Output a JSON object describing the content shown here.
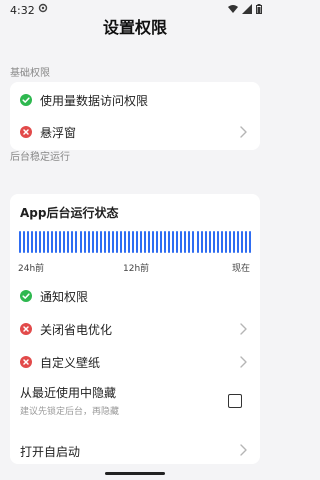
{
  "status_bar": {
    "time": "4:32"
  },
  "page": {
    "title": "设置权限"
  },
  "sections": {
    "basic": {
      "label": "基础权限",
      "items": [
        {
          "label": "使用量数据访问权限",
          "status": "granted"
        },
        {
          "label": "悬浮窗",
          "status": "denied"
        }
      ]
    },
    "background": {
      "label": "后台稳定运行",
      "chart": {
        "title": "App后台运行状态",
        "x_labels": [
          "24h前",
          "12h前",
          "现在"
        ]
      },
      "items": [
        {
          "label": "通知权限",
          "status": "granted"
        },
        {
          "label": "关闭省电优化",
          "status": "denied"
        },
        {
          "label": "自定义壁纸",
          "status": "denied"
        }
      ],
      "hide_recent": {
        "label": "从最近使用中隐藏",
        "note": "建议先锁定后台，再隐藏",
        "checked": false
      },
      "auto_start": {
        "label": "打开自启动"
      }
    }
  },
  "colors": {
    "granted": "#2eb84f",
    "denied": "#e24a4a",
    "bar": "#2f6df2"
  },
  "chart_data": {
    "type": "bar",
    "title": "App后台运行状态",
    "categories": [
      "24h前",
      "12h前",
      "现在"
    ],
    "series": [
      {
        "values": [
          1,
          1,
          1
        ]
      }
    ],
    "ylim": [
      0,
      1
    ]
  }
}
